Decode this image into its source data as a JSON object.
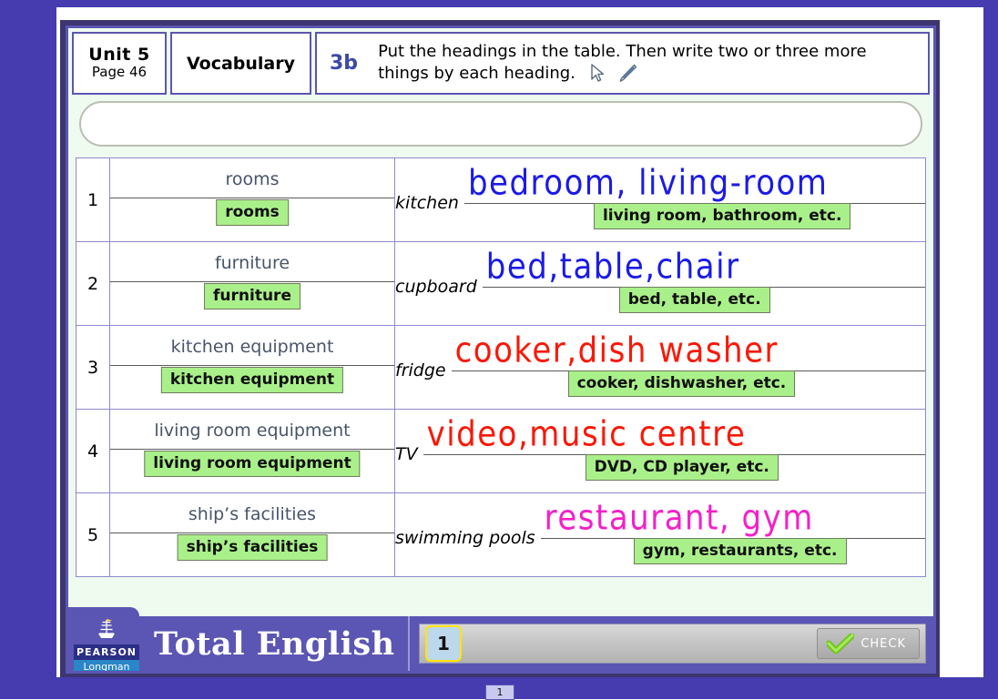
{
  "header": {
    "unit_title": "Unit 5",
    "unit_page": "Page 46",
    "section": "Vocabulary",
    "task_number": "3b",
    "task_text": "Put the headings in the table. Then write two or three more things by each heading.",
    "icons": [
      "cursor-arrow-icon",
      "pen-icon"
    ]
  },
  "wordbank": {
    "placeholder": ""
  },
  "table": {
    "rows": [
      {
        "number": "1",
        "heading_answer": "rooms",
        "heading_tooltip": "rooms",
        "example": "kitchen",
        "handwriting": "bedroom, living-room",
        "ink_color": "#1a1ae8",
        "answer_tooltip": "living room, bathroom, etc."
      },
      {
        "number": "2",
        "heading_answer": "furniture",
        "heading_tooltip": "furniture",
        "example": "cupboard",
        "handwriting": "bed,table,chair",
        "ink_color": "#1a1ae8",
        "answer_tooltip": "bed, table, etc."
      },
      {
        "number": "3",
        "heading_answer": "kitchen equipment",
        "heading_tooltip": "kitchen equipment",
        "example": "fridge",
        "handwriting": "cooker,dish washer",
        "ink_color": "#fa1706",
        "answer_tooltip": "cooker, dishwasher, etc."
      },
      {
        "number": "4",
        "heading_answer": "living room equipment",
        "heading_tooltip": "living room equipment",
        "example": "TV",
        "handwriting": "video,music centre",
        "ink_color": "#fa1706",
        "answer_tooltip": "DVD, CD player, etc."
      },
      {
        "number": "5",
        "heading_answer": "ship’s facilities",
        "heading_tooltip": "ship’s facilities",
        "example": "swimming pools",
        "handwriting": "restaurant, gym",
        "ink_color": "#f420c8",
        "answer_tooltip": "gym, restaurants, etc."
      }
    ]
  },
  "footer": {
    "publisher_primary": "PEARSON",
    "publisher_secondary": "Longman",
    "product_title": "Total English",
    "page_number": "1",
    "check_label": "CHECK"
  },
  "bottom_indicator": {
    "page": "1"
  },
  "colors": {
    "frame": "#5b56b3",
    "tooltip_green": "#aaf08a",
    "accent_blue": "#3b4aa8",
    "page_chip": "#bcd8ec"
  }
}
